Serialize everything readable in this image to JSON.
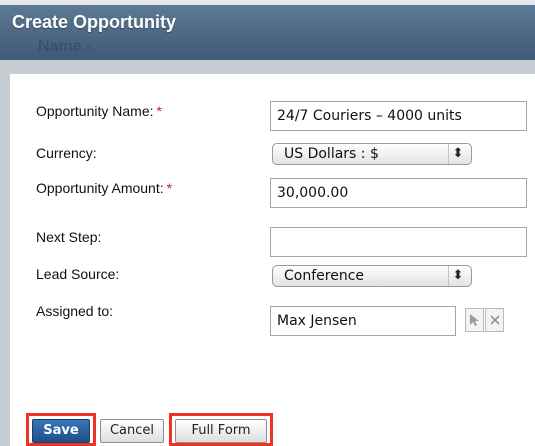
{
  "dialog": {
    "title": "Create Opportunity"
  },
  "background": {
    "column_label": "Name",
    "sort_glyph": "≡"
  },
  "form": {
    "opportunity_name": {
      "label": "Opportunity Name:",
      "required": "*",
      "value": "24/7 Couriers – 4000 units"
    },
    "currency": {
      "label": "Currency:",
      "selected": "US Dollars : $"
    },
    "amount": {
      "label": "Opportunity Amount:",
      "required": "*",
      "value": "30,000.00"
    },
    "next_step": {
      "label": "Next Step:",
      "value": ""
    },
    "lead_source": {
      "label": "Lead Source:",
      "selected": "Conference"
    },
    "assigned_to": {
      "label": "Assigned to:",
      "value": "Max Jensen",
      "select_icon": "cursor-arrow-icon",
      "clear_icon": "close-icon"
    }
  },
  "buttons": {
    "save": "Save",
    "cancel": "Cancel",
    "full_form": "Full Form"
  },
  "colors": {
    "header": "#4a6783",
    "highlight": "#ee3322",
    "required": "#dd1111",
    "primary_button": "#2a5f9e"
  }
}
